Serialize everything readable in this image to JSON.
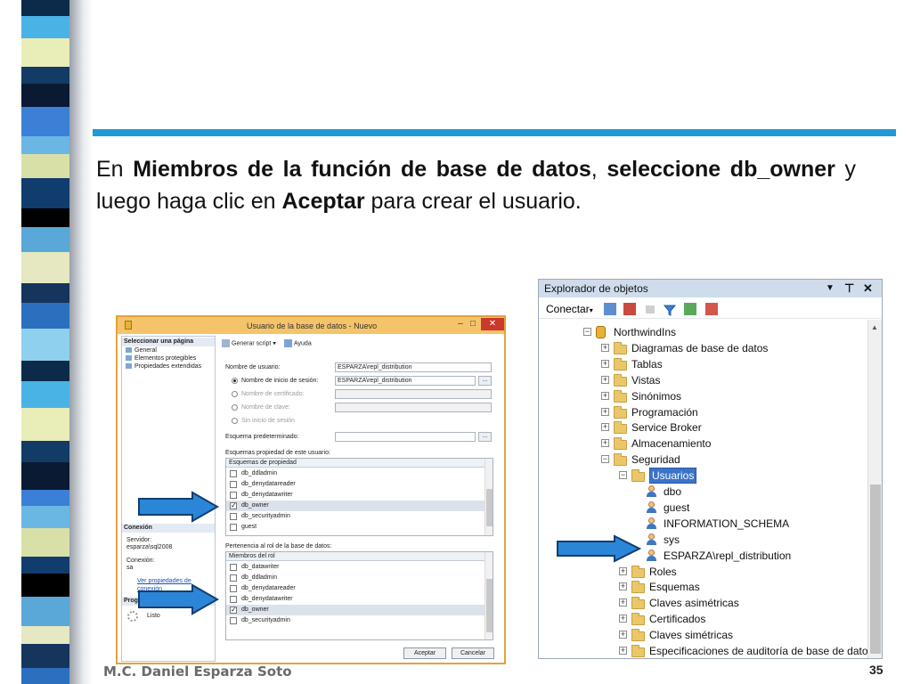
{
  "heading": {
    "part1": "En ",
    "bold1": "Miembros de la función de base de datos",
    "part2": ", ",
    "bold2": "seleccione db_owner",
    "part3": " y luego haga clic en ",
    "bold3": "Aceptar",
    "part4": " para crear el usuario."
  },
  "footer": {
    "author": "M.C. Daniel Esparza Soto",
    "page_number": "35"
  },
  "dialog": {
    "title": "Usuario de la base de datos - Nuevo",
    "select_page_header": "Seleccionar una página",
    "pages": [
      "General",
      "Elementos protegibles",
      "Propiedades extendidas"
    ],
    "connection_header": "Conexión",
    "server_label": "Servidor:",
    "server_value": "esparza\\sql2008",
    "connection_label": "Conexión:",
    "connection_value": "sa",
    "view_connection_properties": "Ver propiedades de conexión",
    "progress_header": "Progreso",
    "progress_status": "Listo",
    "toolbar": {
      "script_label": "Generar script",
      "help_label": "Ayuda"
    },
    "user_name_label": "Nombre de usuario:",
    "user_name_value": "ESPARZA\\repl_distribution",
    "login_name_label": "Nombre de inicio de sesión:",
    "login_name_value": "ESPARZA\\repl_distribution",
    "certificate_name_label": "Nombre de certificado:",
    "key_name_label": "Nombre de clave:",
    "no_login_label": "Sin inicio de sesión",
    "default_schema_label": "Esquema predeterminado:",
    "default_schema_value": "",
    "browse_label": "...",
    "owned_schemas_label": "Esquemas propiedad de este usuario:",
    "owned_schemas_header": "Esquemas de propiedad",
    "owned_schemas": [
      {
        "name": "db_ddladmin",
        "checked": false
      },
      {
        "name": "db_denydatareader",
        "checked": false
      },
      {
        "name": "db_denydatawriter",
        "checked": false
      },
      {
        "name": "db_owner",
        "checked": true
      },
      {
        "name": "db_securityadmin",
        "checked": false
      },
      {
        "name": "guest",
        "checked": false
      }
    ],
    "role_membership_label": "Pertenencia al rol de la base de datos:",
    "role_membership_header": "Miembros del rol",
    "role_members": [
      {
        "name": "db_datawriter",
        "checked": false
      },
      {
        "name": "db_ddladmin",
        "checked": false
      },
      {
        "name": "db_denydatareader",
        "checked": false
      },
      {
        "name": "db_denydatawriter",
        "checked": false
      },
      {
        "name": "db_owner",
        "checked": true
      },
      {
        "name": "db_securityadmin",
        "checked": false
      }
    ],
    "ok_label": "Aceptar",
    "cancel_label": "Cancelar"
  },
  "object_explorer": {
    "title": "Explorador de objetos",
    "connect_label": "Conectar",
    "tree": [
      {
        "label": "NorthwindIns",
        "level": 0,
        "type": "db",
        "expanded": true
      },
      {
        "label": "Diagramas de base de datos",
        "level": 1,
        "type": "folder"
      },
      {
        "label": "Tablas",
        "level": 1,
        "type": "folder"
      },
      {
        "label": "Vistas",
        "level": 1,
        "type": "folder"
      },
      {
        "label": "Sinónimos",
        "level": 1,
        "type": "folder"
      },
      {
        "label": "Programación",
        "level": 1,
        "type": "folder"
      },
      {
        "label": "Service Broker",
        "level": 1,
        "type": "folder"
      },
      {
        "label": "Almacenamiento",
        "level": 1,
        "type": "folder"
      },
      {
        "label": "Seguridad",
        "level": 1,
        "type": "folder",
        "expanded": true
      },
      {
        "label": "Usuarios",
        "level": 2,
        "type": "folder",
        "expanded": true,
        "selected": true
      },
      {
        "label": "dbo",
        "level": 3,
        "type": "user"
      },
      {
        "label": "guest",
        "level": 3,
        "type": "user"
      },
      {
        "label": "INFORMATION_SCHEMA",
        "level": 3,
        "type": "user"
      },
      {
        "label": "sys",
        "level": 3,
        "type": "user"
      },
      {
        "label": "ESPARZA\\repl_distribution",
        "level": 3,
        "type": "user"
      },
      {
        "label": "Roles",
        "level": 2,
        "type": "folder"
      },
      {
        "label": "Esquemas",
        "level": 2,
        "type": "folder"
      },
      {
        "label": "Claves asimétricas",
        "level": 2,
        "type": "folder"
      },
      {
        "label": "Certificados",
        "level": 2,
        "type": "folder"
      },
      {
        "label": "Claves simétricas",
        "level": 2,
        "type": "folder"
      },
      {
        "label": "Especificaciones de auditoría de base de datos",
        "level": 2,
        "type": "folder"
      }
    ]
  },
  "colors": {
    "accent_rule": "#1e9ad6",
    "arrow_fill": "#2b86d8",
    "selection": "#3b73c8"
  }
}
